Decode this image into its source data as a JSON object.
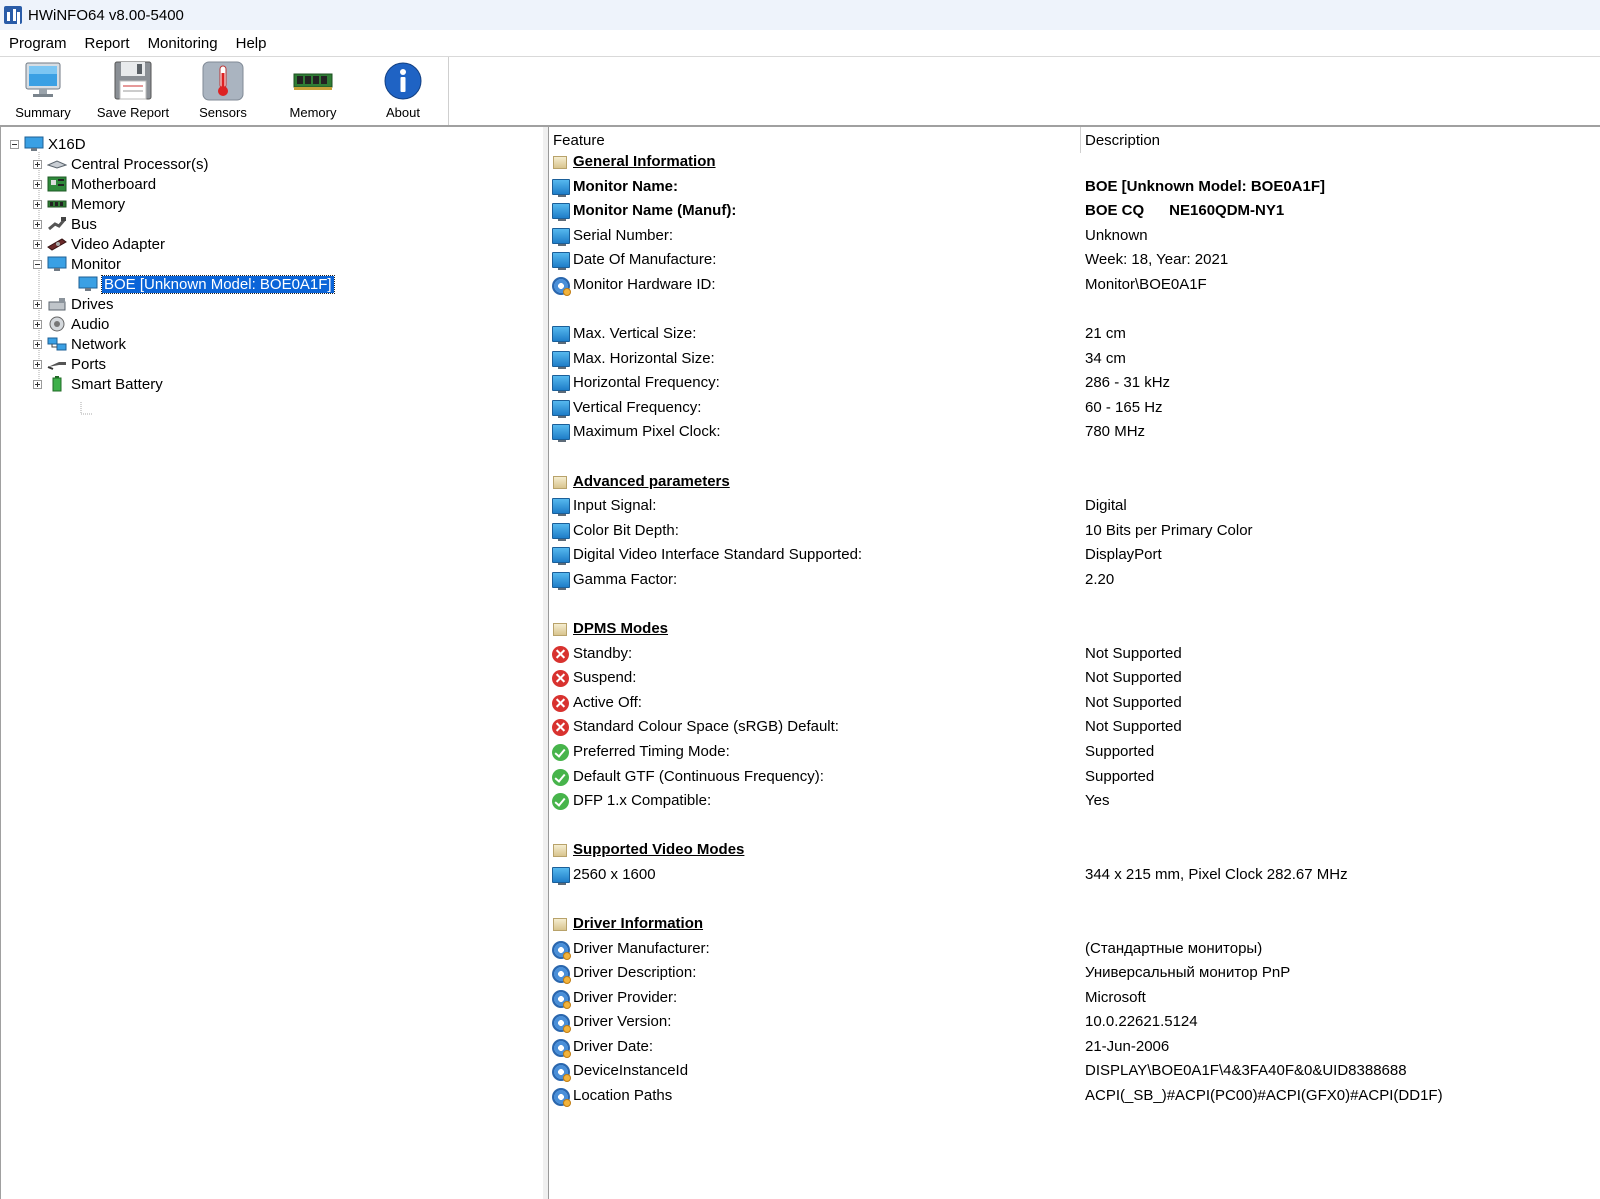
{
  "window": {
    "title": "HWiNFO64 v8.00-5400"
  },
  "menu": [
    "Program",
    "Report",
    "Monitoring",
    "Help"
  ],
  "toolbar": {
    "summary": "Summary",
    "save_report": "Save Report",
    "sensors": "Sensors",
    "memory": "Memory",
    "about": "About"
  },
  "tree": {
    "root": "X16D",
    "items": [
      {
        "label": "Central Processor(s)",
        "icon": "cpu-icon"
      },
      {
        "label": "Motherboard",
        "icon": "motherboard-icon"
      },
      {
        "label": "Memory",
        "icon": "memory-icon"
      },
      {
        "label": "Bus",
        "icon": "bus-icon"
      },
      {
        "label": "Video Adapter",
        "icon": "gpu-icon"
      },
      {
        "label": "Monitor",
        "icon": "monitor-icon"
      },
      {
        "label": "BOE [Unknown Model: BOE0A1F]",
        "icon": "monitor-icon"
      },
      {
        "label": "Drives",
        "icon": "drive-icon"
      },
      {
        "label": "Audio",
        "icon": "audio-icon"
      },
      {
        "label": "Network",
        "icon": "network-icon"
      },
      {
        "label": "Ports",
        "icon": "port-icon"
      },
      {
        "label": "Smart Battery",
        "icon": "battery-icon"
      }
    ]
  },
  "details": {
    "header": {
      "feature": "Feature",
      "description": "Description"
    },
    "rows": [
      {
        "type": "section",
        "icon": "section",
        "f": "General Information",
        "d": ""
      },
      {
        "type": "bold",
        "icon": "mon",
        "f": "Monitor Name:",
        "d": "BOE [Unknown Model: BOE0A1F]"
      },
      {
        "type": "bold",
        "icon": "mon",
        "f": "Monitor Name (Manuf):",
        "d": "BOE CQ      NE160QDM-NY1"
      },
      {
        "type": "normal",
        "icon": "mon",
        "f": "Serial Number:",
        "d": "Unknown"
      },
      {
        "type": "normal",
        "icon": "mon",
        "f": "Date Of Manufacture:",
        "d": "Week: 18, Year: 2021"
      },
      {
        "type": "normal",
        "icon": "gear",
        "f": "Monitor Hardware ID:",
        "d": "Monitor\\BOE0A1F"
      },
      {
        "type": "blank"
      },
      {
        "type": "normal",
        "icon": "mon",
        "f": "Max. Vertical Size:",
        "d": "21 cm"
      },
      {
        "type": "normal",
        "icon": "mon",
        "f": "Max. Horizontal Size:",
        "d": "34 cm"
      },
      {
        "type": "normal",
        "icon": "mon",
        "f": "Horizontal Frequency:",
        "d": "286 - 31 kHz"
      },
      {
        "type": "normal",
        "icon": "mon",
        "f": "Vertical Frequency:",
        "d": "60 - 165 Hz"
      },
      {
        "type": "normal",
        "icon": "mon",
        "f": "Maximum Pixel Clock:",
        "d": "780 MHz"
      },
      {
        "type": "blank"
      },
      {
        "type": "section",
        "icon": "section",
        "f": "Advanced parameters",
        "d": ""
      },
      {
        "type": "normal",
        "icon": "mon",
        "f": "Input Signal:",
        "d": "Digital"
      },
      {
        "type": "normal",
        "icon": "mon",
        "f": "Color Bit Depth:",
        "d": "10 Bits per Primary Color"
      },
      {
        "type": "normal",
        "icon": "mon",
        "f": "Digital Video Interface Standard Supported:",
        "d": "DisplayPort"
      },
      {
        "type": "normal",
        "icon": "mon",
        "f": "Gamma Factor:",
        "d": "2.20"
      },
      {
        "type": "blank"
      },
      {
        "type": "section",
        "icon": "section",
        "f": "DPMS Modes",
        "d": ""
      },
      {
        "type": "normal",
        "icon": "err",
        "f": "Standby:",
        "d": "Not Supported"
      },
      {
        "type": "normal",
        "icon": "err",
        "f": "Suspend:",
        "d": "Not Supported"
      },
      {
        "type": "normal",
        "icon": "err",
        "f": "Active Off:",
        "d": "Not Supported"
      },
      {
        "type": "normal",
        "icon": "err",
        "f": "Standard Colour Space (sRGB) Default:",
        "d": "Not Supported"
      },
      {
        "type": "normal",
        "icon": "ok",
        "f": "Preferred Timing Mode:",
        "d": "Supported"
      },
      {
        "type": "normal",
        "icon": "ok",
        "f": "Default GTF (Continuous Frequency):",
        "d": "Supported"
      },
      {
        "type": "normal",
        "icon": "ok",
        "f": "DFP 1.x Compatible:",
        "d": "Yes"
      },
      {
        "type": "blank"
      },
      {
        "type": "section",
        "icon": "section",
        "f": "Supported Video Modes",
        "d": ""
      },
      {
        "type": "normal",
        "icon": "mon",
        "f": "2560 x 1600",
        "d": "344 x 215 mm, Pixel Clock 282.67 MHz"
      },
      {
        "type": "blank"
      },
      {
        "type": "section",
        "icon": "section",
        "f": "Driver Information",
        "d": ""
      },
      {
        "type": "normal",
        "icon": "gear",
        "f": "Driver Manufacturer:",
        "d": "(Стандартные мониторы)"
      },
      {
        "type": "normal",
        "icon": "gear",
        "f": "Driver Description:",
        "d": "Универсальный монитор PnP"
      },
      {
        "type": "normal",
        "icon": "gear",
        "f": "Driver Provider:",
        "d": "Microsoft"
      },
      {
        "type": "normal",
        "icon": "gear",
        "f": "Driver Version:",
        "d": "10.0.22621.5124"
      },
      {
        "type": "normal",
        "icon": "gear",
        "f": "Driver Date:",
        "d": "21-Jun-2006"
      },
      {
        "type": "normal",
        "icon": "gear",
        "f": "DeviceInstanceId",
        "d": "DISPLAY\\BOE0A1F\\4&3FA40F&0&UID8388688"
      },
      {
        "type": "normal",
        "icon": "gear",
        "f": "Location Paths",
        "d": "ACPI(_SB_)#ACPI(PC00)#ACPI(GFX0)#ACPI(DD1F)"
      }
    ]
  }
}
